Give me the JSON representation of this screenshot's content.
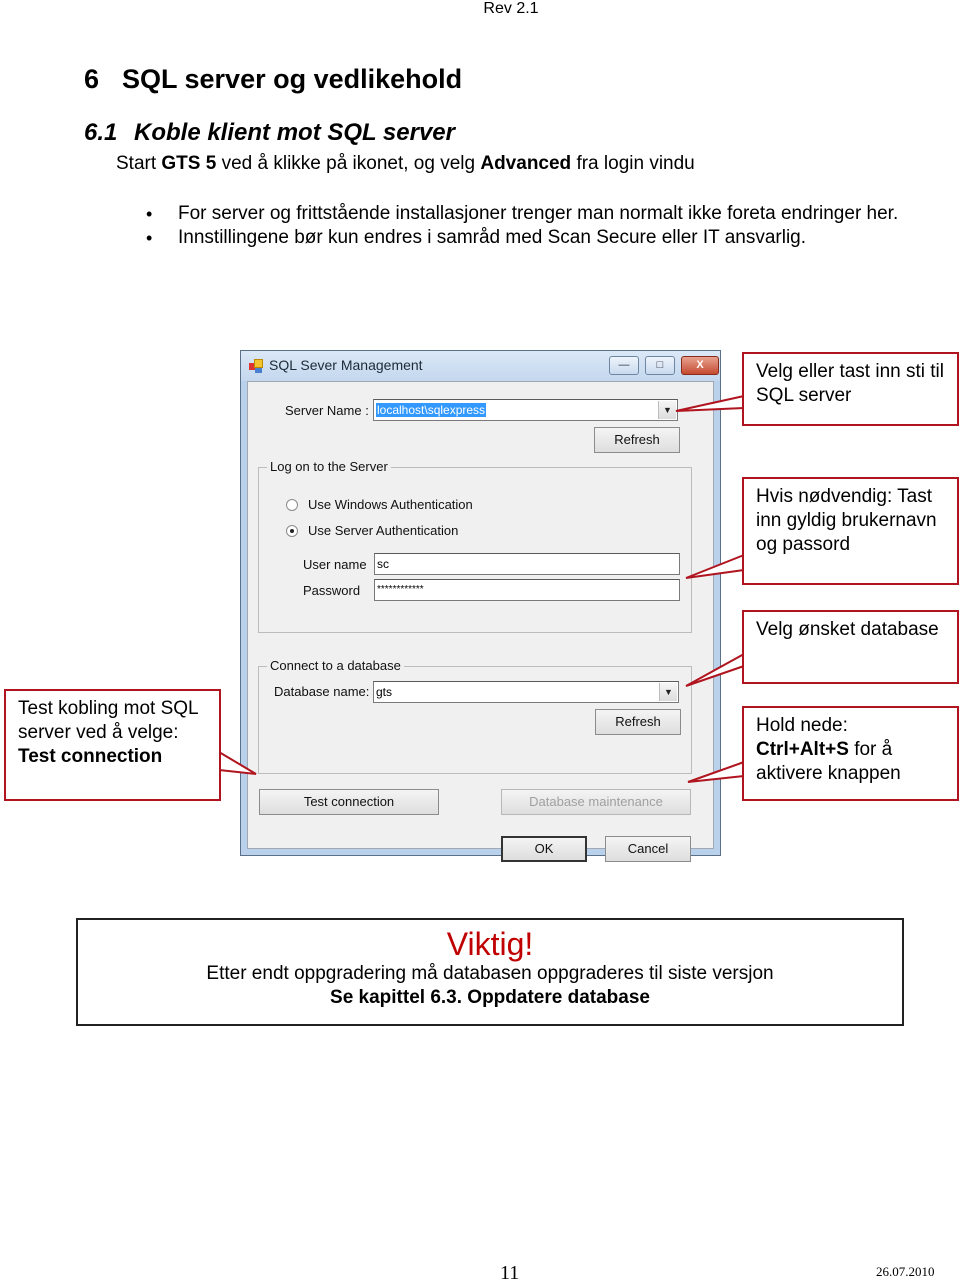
{
  "header": {
    "revision": "Rev 2.1"
  },
  "heading1": {
    "number": "6",
    "title": "SQL server og vedlikehold"
  },
  "heading2": {
    "number": "6.1",
    "title": "Koble klient mot SQL server"
  },
  "intro": {
    "part1": "Start ",
    "bold1": "GTS 5",
    "part2": " ved å klikke på ikonet, og velg ",
    "bold2": "Advanced",
    "part3": " fra login vindu"
  },
  "bullets": [
    "For server og frittstående installasjoner trenger man normalt ikke foreta endringer her.",
    "Innstillingene bør kun endres i samråd med Scan Secure eller IT ansvarlig."
  ],
  "dialog": {
    "title": "SQL Sever Management",
    "icons": {
      "app": "app-icon",
      "minimize": "minimize-icon",
      "maximize": "maximize-icon",
      "close": "close-icon"
    },
    "minimize_glyph": "—",
    "maximize_glyph": "□",
    "close_glyph": "X",
    "server_name_label": "Server Name :",
    "server_name_value": "localhost\\sqlexpress",
    "refresh_label": "Refresh",
    "logon_group": {
      "title": "Log on to the Server",
      "radio_windows": {
        "label": "Use Windows Authentication",
        "checked": false
      },
      "radio_server": {
        "label": "Use Server Authentication",
        "checked": true
      },
      "username_label": "User name",
      "username_value": "sc",
      "password_label": "Password",
      "password_value": "************"
    },
    "database_group": {
      "title": "Connect to a database",
      "database_label": "Database name:",
      "database_value": "gts",
      "refresh_label": "Refresh"
    },
    "test_connection_label": "Test connection",
    "db_maintenance_label": "Database maintenance",
    "ok_label": "OK",
    "cancel_label": "Cancel"
  },
  "callouts": {
    "server_path": "Velg eller tast inn sti til SQL server",
    "credentials": "Hvis nødvendig: Tast inn gyldig brukernavn og passord",
    "database": "Velg ønsket database",
    "maintenance": {
      "line1": "Hold nede:",
      "bold": "Ctrl+Alt+S",
      "rest": " for å aktivere knappen"
    },
    "test": {
      "text": "Test kobling mot SQL server ved å velge:",
      "bold": "Test connection"
    }
  },
  "notice": {
    "title": "Viktig!",
    "line1": "Etter endt oppgradering må databasen oppgraderes til siste versjon",
    "line2": "Se kapittel 6.3. Oppdatere database",
    "title_color": "#c00000"
  },
  "footer": {
    "page_number": "11",
    "date": "26.07.2010"
  }
}
